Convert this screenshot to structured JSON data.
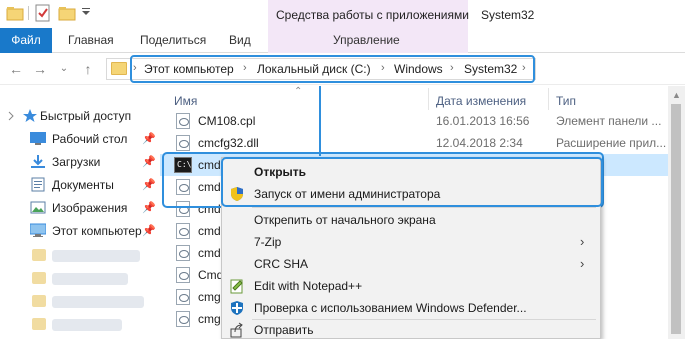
{
  "title_bar": {
    "window_title": "System32",
    "context_group": "Средства работы с приложениями"
  },
  "ribbon": {
    "tabs": [
      {
        "label": "Файл",
        "active": true
      },
      {
        "label": "Главная"
      },
      {
        "label": "Поделиться"
      },
      {
        "label": "Вид"
      },
      {
        "label": "Управление"
      }
    ]
  },
  "address_bar": {
    "crumbs": [
      "Этот компьютер",
      "Локальный диск (C:)",
      "Windows",
      "System32"
    ]
  },
  "nav_pane": {
    "items": [
      {
        "label": "Быстрый доступ",
        "icon": "star-icon",
        "pinned": false
      },
      {
        "label": "Рабочий стол",
        "icon": "desktop-icon",
        "pinned": true
      },
      {
        "label": "Загрузки",
        "icon": "downloads-icon",
        "pinned": true
      },
      {
        "label": "Документы",
        "icon": "documents-icon",
        "pinned": true
      },
      {
        "label": "Изображения",
        "icon": "pictures-icon",
        "pinned": true
      },
      {
        "label": "Этот компьютер",
        "icon": "computer-icon",
        "pinned": true
      }
    ]
  },
  "file_list": {
    "columns": [
      "Имя",
      "Дата изменения",
      "Тип"
    ],
    "rows": [
      {
        "name": "CM108.cpl",
        "date": "16.01.2013 16:56",
        "type": "Элемент панели ..."
      },
      {
        "name": "cmcfg32.dll",
        "date": "12.04.2018 2:34",
        "type": "Расширение прил..."
      },
      {
        "name": "cmd",
        "date": "",
        "type": "ение",
        "selected": true,
        "icon": "cmd-icon"
      },
      {
        "name": "cmd",
        "date": "",
        "type": "ение"
      },
      {
        "name": "cmd",
        "date": "",
        "type": "ение"
      },
      {
        "name": "cmd",
        "date": "",
        "type": "ение"
      },
      {
        "name": "cmd",
        "date": "",
        "type": "ение"
      },
      {
        "name": "Cmd",
        "date": "",
        "type": "ение"
      },
      {
        "name": "cmg",
        "date": "",
        "type": "ение"
      },
      {
        "name": "cmg",
        "date": "",
        "type": "ение"
      },
      {
        "name": "Cmi",
        "date": "",
        "type": "ение"
      }
    ]
  },
  "context_menu": {
    "items": [
      {
        "label": "Открыть",
        "bold": true,
        "icon": ""
      },
      {
        "label": "Запуск от имени администратора",
        "icon": "uac-shield-icon"
      },
      {
        "label": "Открепить от начального экрана",
        "icon": ""
      },
      {
        "label": "7-Zip",
        "icon": "",
        "submenu": true
      },
      {
        "label": "CRC SHA",
        "icon": "",
        "submenu": true
      },
      {
        "label": "Edit with Notepad++",
        "icon": "notepad-plus-icon"
      },
      {
        "label": "Проверка с использованием Windows Defender...",
        "icon": "defender-icon"
      },
      {
        "label": "Отправить",
        "icon": "share-icon"
      }
    ]
  },
  "colors": {
    "accent": "#1979ca",
    "highlight": "#2f8fdd",
    "selection": "#cce8ff",
    "context_tab": "#f3e7f7"
  }
}
